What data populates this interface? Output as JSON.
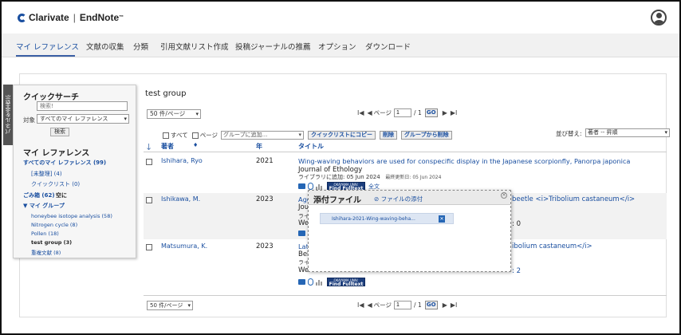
{
  "brand": {
    "logo": "Clarivate",
    "separator": "|",
    "product": "EndNote",
    "tm": "™"
  },
  "nav": {
    "items": [
      "マイ レファレンス",
      "文献の収集",
      "分類",
      "引用文献リスト作成",
      "投稿ジャーナルの推薦",
      "オプション",
      "ダウンロード"
    ]
  },
  "panel_tab": "パネルを非表示",
  "sidebar": {
    "title": "クイックサーチ",
    "search_placeholder": "検索!",
    "target_label": "対象",
    "target_value": "すべてのマイ レファレンス",
    "search_button": "検索",
    "my_refs_title": "マイ レファレンス",
    "all_refs": "すべてのマイ レファレンス (99)",
    "unfiled": "[未整理] (4)",
    "quick_list": "クイックリスト (0)",
    "trash": "ごみ箱 (62)",
    "trash_empty": "空に",
    "my_groups": "▼ マイ グループ",
    "groups": [
      "honeybee isotope analysis (58)",
      "Nitrogen cycle (8)",
      "Pollen (18)",
      "test group (3)",
      "重複文献 (8)"
    ]
  },
  "main": {
    "title": "test group",
    "per_page": "50 件/ページ",
    "pager": {
      "page_label": "ページ",
      "page_value": "1",
      "total": "/ 1",
      "go": "GO"
    },
    "toolbar": {
      "all": "すべて",
      "page": "ページ",
      "group_select": "グループに追加...",
      "copy_quick": "クイックリストにコピー",
      "delete": "削除",
      "remove_group": "グループから削除"
    },
    "sort_label": "並び替え:",
    "sort_value": "著者 -- 昇順",
    "columns": {
      "author": "著者",
      "year": "年",
      "title": "タイトル"
    },
    "rows": [
      {
        "author": "Ishihara, Ryo",
        "year": "2021",
        "title": "Wing-waving behaviors are used for conspecific display in the Japanese scorpionfly, Panorpa japonica",
        "journal": "Journal of Ethology",
        "meta_added": "ライブラリに追加: 05 Jun 2024",
        "meta_updated": "最終更新日: 05 Jun 2024",
        "find_fulltext": "Find Fulltext",
        "univ": "OKAYAMA UNIV.",
        "fulltext": "全文"
      },
      {
        "author": "Ishikawa, M.",
        "year": "2023",
        "title_start": "Agg",
        "title_end": "beetle <i>Tribolium castaneum</i>",
        "journal_start": "Jou",
        "meta_start": "ライ",
        "web_start": "We",
        "cited_end": ": 0"
      },
      {
        "author": "Matsumura, K.",
        "year": "2023",
        "title_start": "Lat",
        "title_end": "ibolium castaneum</i>",
        "journal_start": "Beh",
        "meta_start": "ライ",
        "web_start": "We",
        "cited_end": ": 2",
        "find_fulltext": "Find Fulltext",
        "univ": "OKAYAMA UNIV."
      }
    ],
    "bottom_per_page": "50 件/ページ"
  },
  "popup": {
    "title": "添付ファイル",
    "add": "ファイルの添付",
    "file_name": "Ishihara-2021-Wing-waving-beha...",
    "close": "×"
  }
}
